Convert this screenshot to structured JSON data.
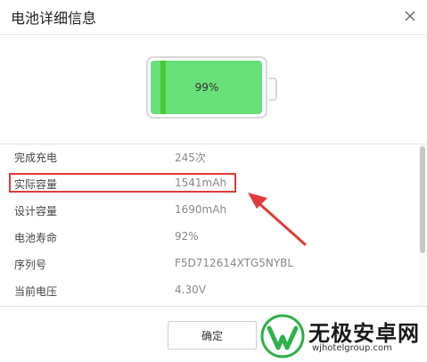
{
  "window": {
    "title": "电池详细信息"
  },
  "battery": {
    "percent_label": "99%",
    "level": 0.99,
    "fill_color": "#68e07a",
    "accent_color": "#48c934"
  },
  "info": {
    "rows": [
      {
        "label": "完成充电",
        "value": "245次"
      },
      {
        "label": "实际容量",
        "value": "1541mAh"
      },
      {
        "label": "设计容量",
        "value": "1690mAh"
      },
      {
        "label": "电池寿命",
        "value": "92%"
      },
      {
        "label": "序列号",
        "value": "F5D712614XTG5NYBL"
      },
      {
        "label": "当前电压",
        "value": "4.30V"
      }
    ]
  },
  "footer": {
    "ok_label": "确定"
  },
  "annotation": {
    "color": "#e03a3a"
  },
  "watermark": {
    "title": "无极安卓网",
    "url": "wjhotelgroup.com"
  }
}
